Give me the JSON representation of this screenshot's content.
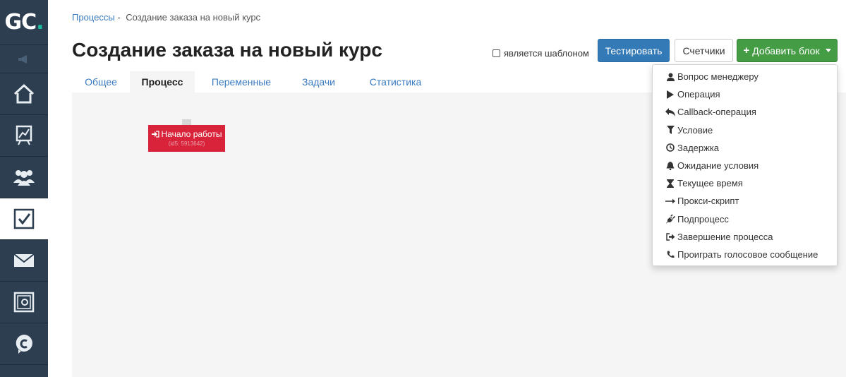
{
  "app": {
    "logo_text": "GC",
    "logo_dot": "."
  },
  "breadcrumb": {
    "parent": "Процессы",
    "separator": "-",
    "current": "Создание заказа на новый курс"
  },
  "page_title": "Создание заказа на новый курс",
  "template_checkbox": {
    "label": "является шаблоном",
    "checked": false
  },
  "toolbar": {
    "test_label": "Тестировать",
    "counters_label": "Счетчики",
    "add_block_label": "Добавить блок",
    "add_block_plus": "+"
  },
  "tabs": [
    {
      "label": "Общее",
      "active": false
    },
    {
      "label": "Процесс",
      "active": true
    },
    {
      "label": "Переменные",
      "active": false
    },
    {
      "label": "Задачи",
      "active": false
    },
    {
      "label": "Статистика",
      "active": false
    }
  ],
  "canvas": {
    "start_node": {
      "title": "Начало работы",
      "id_text": "(id5: 5913642)"
    }
  },
  "add_block_menu": [
    {
      "label": "Вопрос менеджеру",
      "icon": "user-icon"
    },
    {
      "label": "Операция",
      "icon": "play-icon"
    },
    {
      "label": "Callback-операция",
      "icon": "reply-icon"
    },
    {
      "label": "Условие",
      "icon": "filter-icon"
    },
    {
      "label": "Задержка",
      "icon": "clock-icon"
    },
    {
      "label": "Ожидание условия",
      "icon": "bell-icon"
    },
    {
      "label": "Текущее время",
      "icon": "hourglass-icon"
    },
    {
      "label": "Прокси-скрипт",
      "icon": "arrow-right-icon"
    },
    {
      "label": "Подпроцесс",
      "icon": "plug-icon"
    },
    {
      "label": "Завершение процесса",
      "icon": "sign-out-icon"
    },
    {
      "label": "Проиграть голосовое сообщение",
      "icon": "phone-icon"
    }
  ],
  "colors": {
    "sidebar_bg": "#2c3e50",
    "primary": "#337ab7",
    "success": "#449d44",
    "node_red": "#d9233a",
    "link": "#3b7bbf"
  }
}
